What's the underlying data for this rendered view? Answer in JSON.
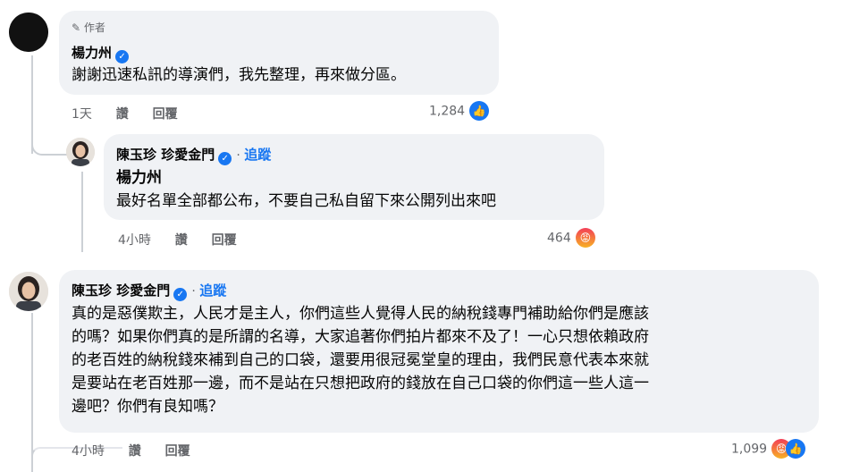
{
  "comment1": {
    "badge": "作者",
    "author": "楊力州",
    "text": "謝謝迅速私訊的導演們，我先整理，再來做分區。",
    "time": "1天",
    "like_label": "讚",
    "reply_label": "回覆",
    "reaction_count": "1,284",
    "reaction_icons": [
      "like-icon"
    ]
  },
  "reply1": {
    "author": "陳玉珍 珍愛金門",
    "follow_label": "追蹤",
    "mention": "楊力州",
    "text": "最好名單全部都公布，不要自己私自留下來公開列出來吧",
    "time": "4小時",
    "like_label": "讚",
    "reply_label": "回覆",
    "reaction_count": "464",
    "reaction_icons": [
      "angry-icon"
    ]
  },
  "comment2": {
    "author": "陳玉珍 珍愛金門",
    "follow_label": "追蹤",
    "lines": [
      "真的是惡僕欺主，人民才是主人，你們這些人覺得人民的納稅錢專門補助給你們是應該",
      "的嗎？如果你們真的是所謂的名導，大家追著你們拍片都來不及了！一心只想依賴政府",
      "的老百姓的納稅錢來補到自己的口袋，還要用很冠冕堂皇的理由，我們民意代表本來就",
      "是要站在老百姓那一邊，而不是站在只想把政府的錢放在自己口袋的你們這一些人這一",
      "邊吧？你們有良知嗎？"
    ],
    "time": "4小時",
    "like_label": "讚",
    "reply_label": "回覆",
    "reaction_count": "1,099",
    "reaction_icons": [
      "angry-icon",
      "like-icon"
    ]
  },
  "colors": {
    "accent": "#1877f2",
    "bubble": "#f0f2f5",
    "meta": "#65676b"
  }
}
